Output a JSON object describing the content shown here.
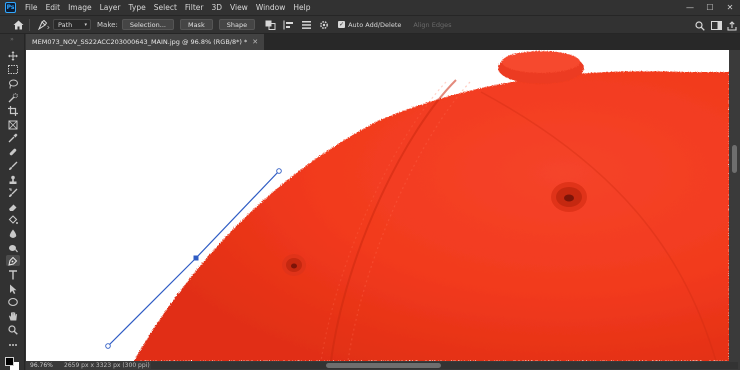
{
  "menubar": {
    "logo": "Ps",
    "items": [
      "File",
      "Edit",
      "Image",
      "Layer",
      "Type",
      "Select",
      "Filter",
      "3D",
      "View",
      "Window",
      "Help"
    ],
    "window_controls": [
      "—",
      "☐",
      "✕"
    ]
  },
  "options": {
    "mode_value": "Path",
    "make_label": "Make:",
    "selection_button": "Selection...",
    "mask_button": "Mask",
    "shape_button": "Shape",
    "auto_add_delete": "Auto Add/Delete",
    "auto_add_delete_checked": true,
    "align_edges": "Align Edges"
  },
  "document": {
    "tab_title": "MEM073_NOV_SS22ACC203000643_MAIN.jpg @ 96.8% (RGB/8*) *",
    "close_glyph": "✕"
  },
  "status": {
    "zoom": "96.76%",
    "info": "2659 px x 3323 px (300 ppi)",
    "arrow": "›"
  },
  "image": {
    "subject": "red baseball cap crown with button, seams and eyelets",
    "cap_color": "#f43a1c",
    "path_color": "#2f5cc4"
  }
}
